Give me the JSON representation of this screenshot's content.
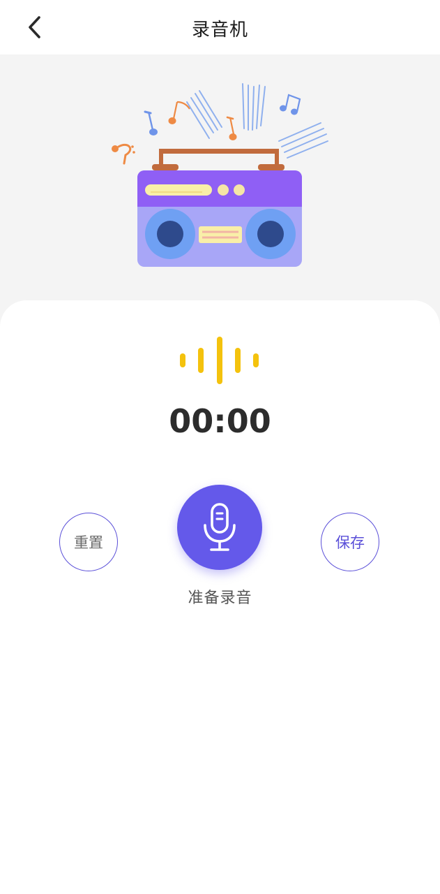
{
  "header": {
    "title": "录音机",
    "back_icon": "chevron-left-icon"
  },
  "illustration": {
    "name": "radio-boombox-illustration",
    "colors": {
      "body": "#a8a6f7",
      "top_panel": "#8f5ff5",
      "handle": "#c16b3d",
      "speaker_outer": "#6fa0f3",
      "speaker_inner": "#2e4a8c",
      "display": "#f9efa8",
      "note_orange": "#ee8a44",
      "note_blue": "#6f94e9"
    }
  },
  "recorder": {
    "wave_icon": "sound-wave-icon",
    "wave_color": "#f4c20d",
    "timer": "00:00",
    "status": "准备录音",
    "accent_color": "#6459ea"
  },
  "controls": {
    "reset_label": "重置",
    "save_label": "保存",
    "mic_icon": "microphone-icon"
  }
}
